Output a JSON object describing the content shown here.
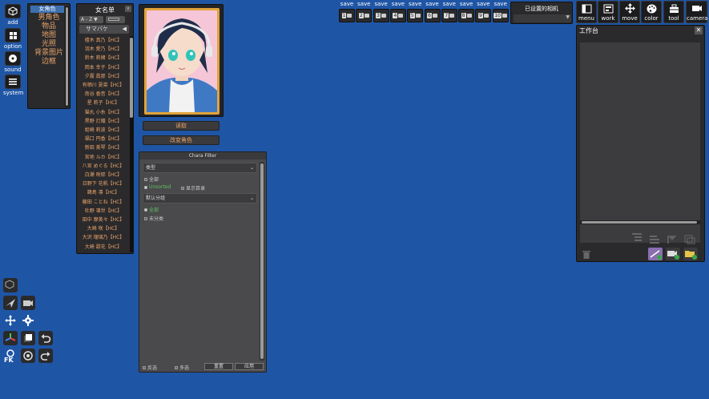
{
  "left_menu": [
    {
      "name": "add",
      "label": "add",
      "icon": "cube-icon"
    },
    {
      "name": "option",
      "label": "option",
      "icon": "grid-icon"
    },
    {
      "name": "sound",
      "label": "sound",
      "icon": "disc-icon"
    },
    {
      "name": "system",
      "label": "system",
      "icon": "menu-icon"
    }
  ],
  "categories": {
    "selected": "女角色",
    "items": [
      "男角色",
      "物品",
      "地图",
      "光照",
      "背景图片",
      "边框"
    ]
  },
  "female_list": {
    "title": "女名单",
    "sort": "A - Z ▼",
    "group": "サマバケ",
    "items": [
      "檀木 真乃【HC】",
      "羽木 愛乃【HC】",
      "鈴木 莉緒【HC】",
      "岡本 幸子【HC】",
      "夕霧 眞那【HC】",
      "有栖川 夏菜【HC】",
      "南谷 香音【HC】",
      "星 莉子【HC】",
      "猫丸 小糸【HC】",
      "黒野 灯織【HC】",
      "姫崎 莉波【HC】",
      "福口 円香【HC】",
      "新田 美琴【HC】",
      "宮地 ルカ【HC】",
      "八宮 めぐる【HC】",
      "白瀬 咲耶【HC】",
      "日野下 花帆【HC】",
      "鵜島 凛【HC】",
      "藤田 ことね【HC】",
      "杜野 凛世【HC】",
      "田中 摩美々【HC】",
      "大崎 咲【HC】",
      "大沢 瑠璃乃【HC】",
      "大崎 甜花【HC】"
    ]
  },
  "portrait_buttons": {
    "load": "读取",
    "change": "改变角色"
  },
  "filter": {
    "title": "Chara Filter",
    "dropdown1": "类型",
    "check1": "全部",
    "check2a": "Unsorted",
    "check2b": "显示目录",
    "dropdown2": "默认分组",
    "check3": "全部",
    "check4": "未分类",
    "bottom_check1": "反选",
    "bottom_check2": "多选",
    "btn_confirm": "重置",
    "btn_cancel": "应用"
  },
  "saves": [
    {
      "label": "save",
      "num": "1"
    },
    {
      "label": "save",
      "num": "2"
    },
    {
      "label": "save",
      "num": "3"
    },
    {
      "label": "save",
      "num": "4"
    },
    {
      "label": "save",
      "num": "5"
    },
    {
      "label": "save",
      "num": "6"
    },
    {
      "label": "save",
      "num": "7"
    },
    {
      "label": "save",
      "num": "8"
    },
    {
      "label": "save",
      "num": "9"
    },
    {
      "label": "save",
      "num": "10"
    }
  ],
  "camera_dropdown": "已设置的相机",
  "tools": [
    {
      "label": "menu",
      "icon": "window-icon"
    },
    {
      "label": "work",
      "icon": "workspace-icon"
    },
    {
      "label": "move",
      "icon": "move-arrows-icon"
    },
    {
      "label": "color",
      "icon": "palette-icon"
    },
    {
      "label": "tool",
      "icon": "toolbox-icon"
    },
    {
      "label": "camera",
      "icon": "camera-icon"
    }
  ],
  "workspace": {
    "title": "工作台",
    "close": "✕"
  },
  "colors": {
    "background": "#1f55a5",
    "accent_text": "#e8a36a",
    "panel": "#2a2a2c",
    "portrait_frame": "#e0a33b"
  }
}
